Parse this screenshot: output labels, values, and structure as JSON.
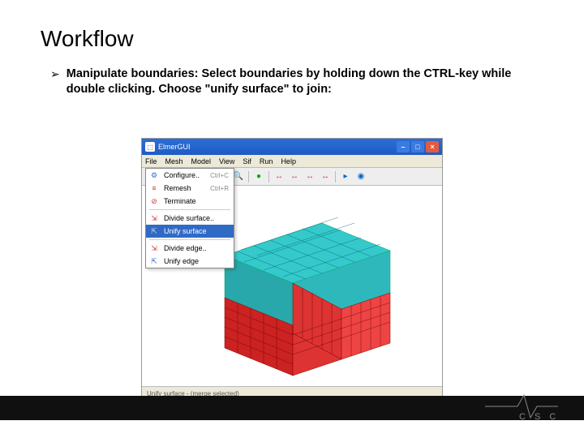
{
  "slide": {
    "title": "Workflow",
    "bullet": "Manipulate boundaries: Select boundaries by holding down the CTRL-key while double clicking. Choose \"unify surface\" to join:"
  },
  "window": {
    "title": "ElmerGUI",
    "menus": [
      "File",
      "Mesh",
      "Model",
      "View",
      "Sif",
      "Run",
      "Help"
    ],
    "buttons": {
      "min": "–",
      "max": "□",
      "close": "×"
    }
  },
  "dropdown": {
    "items": [
      {
        "label": "Configure..",
        "shortcut": "Ctrl+C",
        "icon": "⚙",
        "color": "#2a6ed8"
      },
      {
        "label": "Remesh",
        "shortcut": "Ctrl+R",
        "icon": "≡",
        "color": "#c33"
      },
      {
        "label": "Terminate",
        "icon": "⊘",
        "color": "#c33"
      },
      {
        "label": "Divide surface..",
        "icon": "⇲",
        "color": "#c33"
      },
      {
        "label": "Unify surface",
        "selected": true,
        "icon": "⇱",
        "color": "#36c"
      },
      {
        "label": "Divide edge..",
        "icon": "⇲",
        "color": "#c33"
      },
      {
        "label": "Unify edge",
        "icon": "⇱",
        "color": "#36c"
      }
    ]
  },
  "statusbar": "Unify surface - (merge selected)",
  "toolbar": {
    "icons": [
      "📂",
      "💾",
      "sep",
      "⬛",
      "⬜",
      "sep",
      "✎",
      "🔍",
      "sep",
      "🟢",
      "sep",
      "↔",
      "↔",
      "↔",
      "↔",
      "sep",
      "▶",
      "◉"
    ]
  },
  "logo": "C S C"
}
